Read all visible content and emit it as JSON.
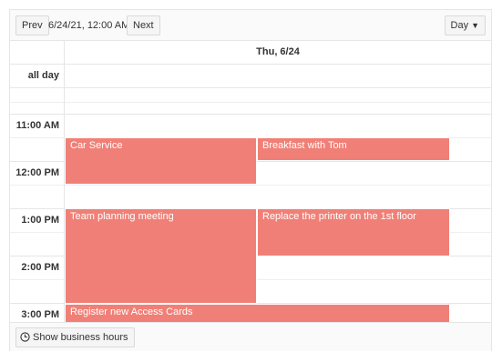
{
  "toolbar": {
    "prev_label": "Prev",
    "current_date": "6/24/21, 12:00 AM",
    "next_label": "Next",
    "view_label": "Day",
    "view_caret": "▼"
  },
  "day_header": "Thu, 6/24",
  "all_day_label": "all day",
  "time_labels": [
    "11:00 AM",
    "12:00 PM",
    "1:00 PM",
    "2:00 PM",
    "3:00 PM"
  ],
  "events": [
    {
      "title": "Car Service"
    },
    {
      "title": "Breakfast with Tom"
    },
    {
      "title": "Team planning meeting"
    },
    {
      "title": "Replace the printer on the 1st floor"
    },
    {
      "title": "Register new Access Cards"
    }
  ],
  "footer": {
    "business_hours_label": "Show business hours",
    "clock_icon": "clock-icon"
  },
  "colors": {
    "event": "#f08077",
    "border": "#e6e6e6",
    "toolbar_bg": "#fafafa"
  }
}
